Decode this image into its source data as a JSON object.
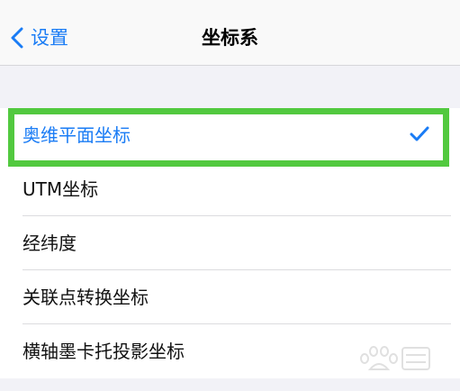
{
  "nav": {
    "back_label": "设置",
    "title": "坐标系"
  },
  "options": [
    {
      "label": "奥维平面坐标",
      "selected": true
    },
    {
      "label": "UTM坐标",
      "selected": false
    },
    {
      "label": "经纬度",
      "selected": false
    },
    {
      "label": "关联点转换坐标",
      "selected": false
    },
    {
      "label": "横轴墨卡托投影坐标",
      "selected": false
    }
  ],
  "colors": {
    "accent": "#1a7cf5",
    "highlight_border": "#52c93f",
    "background": "#f2f2f7"
  },
  "icons": {
    "back": "chevron-left-icon",
    "selected": "checkmark-icon",
    "watermark": "baidu-jingyan-watermark"
  }
}
